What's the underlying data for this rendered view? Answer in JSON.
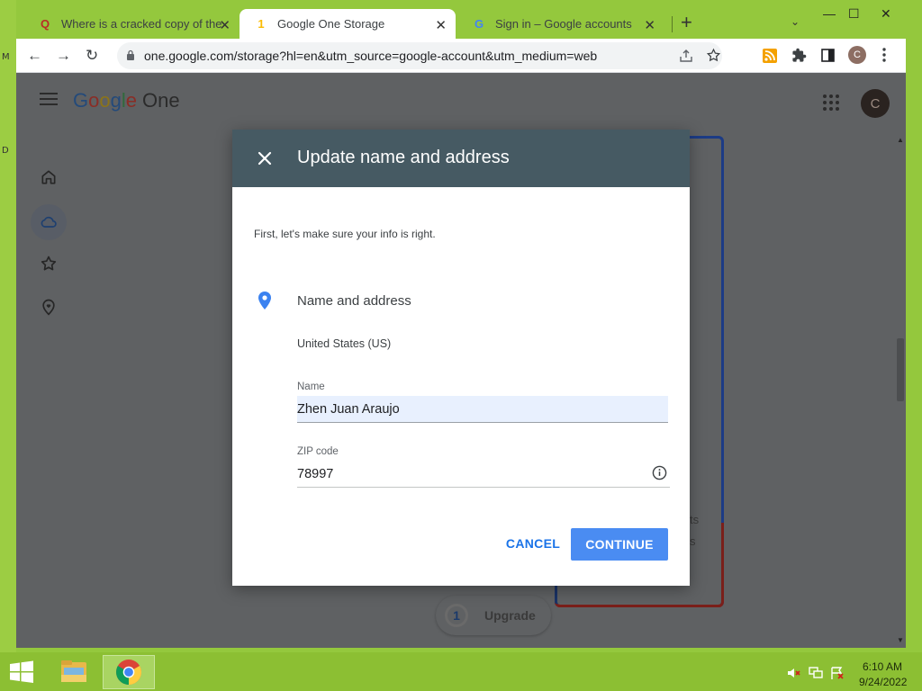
{
  "browser": {
    "tabs": [
      {
        "title": "Where is a cracked copy of the C",
        "favicon": "quora-icon",
        "favicon_glyph": "Q",
        "close": "✕"
      },
      {
        "title": "Google One Storage",
        "favicon": "google-one-icon",
        "favicon_glyph": "1",
        "close": "✕",
        "active": true
      },
      {
        "title": "Sign in – Google accounts",
        "favicon": "google-g-icon",
        "favicon_glyph": "G",
        "close": "✕"
      }
    ],
    "new_tab": "+",
    "tab_search": "⌄",
    "window_controls": {
      "minimize": "—",
      "maximize": "☐",
      "close": "✕"
    },
    "toolbar": {
      "back": "←",
      "forward": "→",
      "reload": "↻",
      "url": "one.google.com/storage?hl=en&utm_source=google-account&utm_medium=web",
      "profile_initial": "C"
    }
  },
  "app": {
    "logo": {
      "letters": [
        "G",
        "o",
        "o",
        "g",
        "l",
        "e"
      ],
      "product": "One"
    },
    "avatar_initial": "C",
    "nav": [
      {
        "name": "home",
        "icon": "home-icon"
      },
      {
        "name": "storage",
        "icon": "cloud-icon",
        "active": true
      },
      {
        "name": "benefits",
        "icon": "star-icon"
      },
      {
        "name": "support",
        "icon": "heart-location-icon"
      }
    ],
    "background_fragments": [
      "ts",
      "s"
    ],
    "upgrade_label": "Upgrade"
  },
  "dialog": {
    "title": "Update name and address",
    "intro": "First, let's make sure your info is right.",
    "section_title": "Name and address",
    "country": "United States (US)",
    "name_label": "Name",
    "name_value": "Zhen Juan Araujo",
    "zip_label": "ZIP code",
    "zip_value": "78997",
    "cancel_label": "CANCEL",
    "continue_label": "CONTINUE"
  },
  "taskbar": {
    "time": "6:10 AM",
    "date": "9/24/2022"
  },
  "desktop": {
    "edge_glyphs": [
      "M",
      "D"
    ]
  },
  "colors": {
    "dialog_header": "#465a63",
    "primary_blue": "#4a8cf2",
    "link_blue": "#1a73e8",
    "desktop_green": "#94c83d",
    "overlay_gray": "#5f6163"
  }
}
